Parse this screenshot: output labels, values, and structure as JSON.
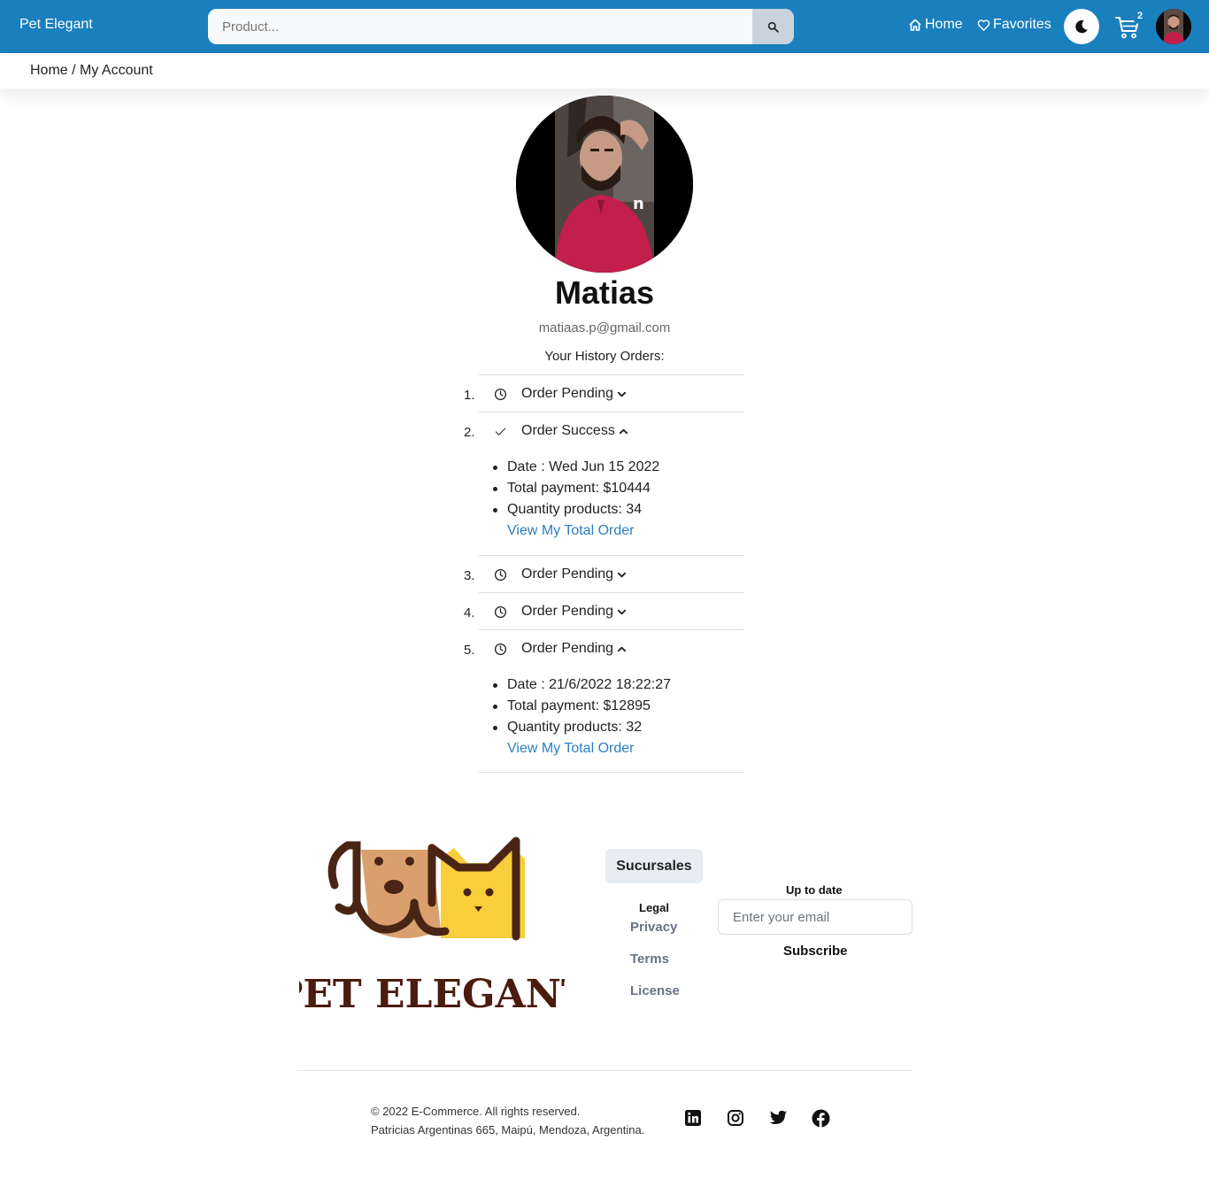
{
  "navbar": {
    "brand": "Pet Elegant",
    "search_placeholder": "Product...",
    "home_label": "Home",
    "favorites_label": "Favorites",
    "cart_count": "2",
    "color": "#1a7fbd"
  },
  "breadcrumb": "Home / My Account",
  "profile": {
    "name": "Matias",
    "email": "matiaas.p@gmail.com",
    "history_title": "Your History Orders:"
  },
  "orders": [
    {
      "number": "1.",
      "status": "Order Pending",
      "icon": "clock-icon",
      "expanded": false
    },
    {
      "number": "2.",
      "status": "Order Success",
      "icon": "check-icon",
      "expanded": true,
      "date": "Date : Wed Jun 15 2022",
      "total": "Total payment: $10444",
      "quantity": "Quantity products: 34",
      "link": "View My Total Order"
    },
    {
      "number": "3.",
      "status": "Order Pending",
      "icon": "clock-icon",
      "expanded": false
    },
    {
      "number": "4.",
      "status": "Order Pending",
      "icon": "clock-icon",
      "expanded": false
    },
    {
      "number": "5.",
      "status": "Order Pending",
      "icon": "clock-icon",
      "expanded": true,
      "date": "Date : 21/6/2022 18:22:27",
      "total": "Total payment: $12895",
      "quantity": "Quantity products: 32",
      "link": "View My Total Order"
    }
  ],
  "footer": {
    "logo_text": "PET ELEGANT",
    "sucursales": "Sucursales",
    "legal_title": "Legal",
    "privacy": "Privacy",
    "terms": "Terms",
    "license": "License",
    "up_to_date": "Up to date",
    "email_placeholder": "Enter your email",
    "subscribe": "Subscribe",
    "copyright": "© 2022 E-Commerce. All rights reserved.",
    "address": "Patricias Argentinas 665, Maipú, Mendoza, Argentina.",
    "social": [
      "linkedin-icon",
      "instagram-icon",
      "twitter-icon",
      "facebook-icon"
    ]
  }
}
